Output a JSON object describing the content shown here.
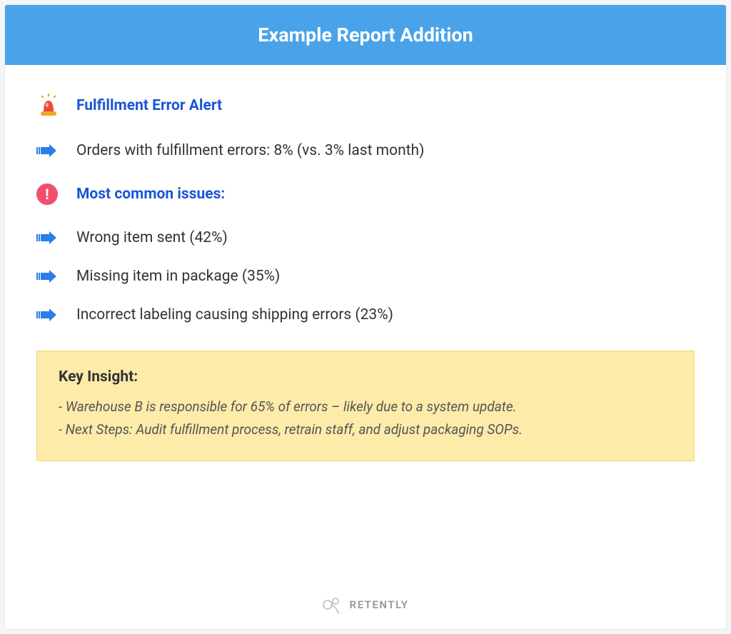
{
  "header": {
    "title": "Example Report Addition"
  },
  "sections": {
    "alert_title": "Fulfillment Error Alert",
    "orders_line": "Orders with fulfillment errors: 8% (vs. 3% last month)",
    "issues_title": "Most common issues:",
    "issues": [
      "Wrong item sent (42%)",
      "Missing item in package (35%)",
      "Incorrect labeling causing shipping errors (23%)"
    ]
  },
  "insight": {
    "title": "Key Insight:",
    "lines": [
      "- Warehouse B is responsible for 65% of errors – likely due to a system update.",
      "- Next Steps: Audit fulfillment process, retrain staff, and adjust packaging SOPs."
    ]
  },
  "footer": {
    "brand": "RETENTLY"
  }
}
